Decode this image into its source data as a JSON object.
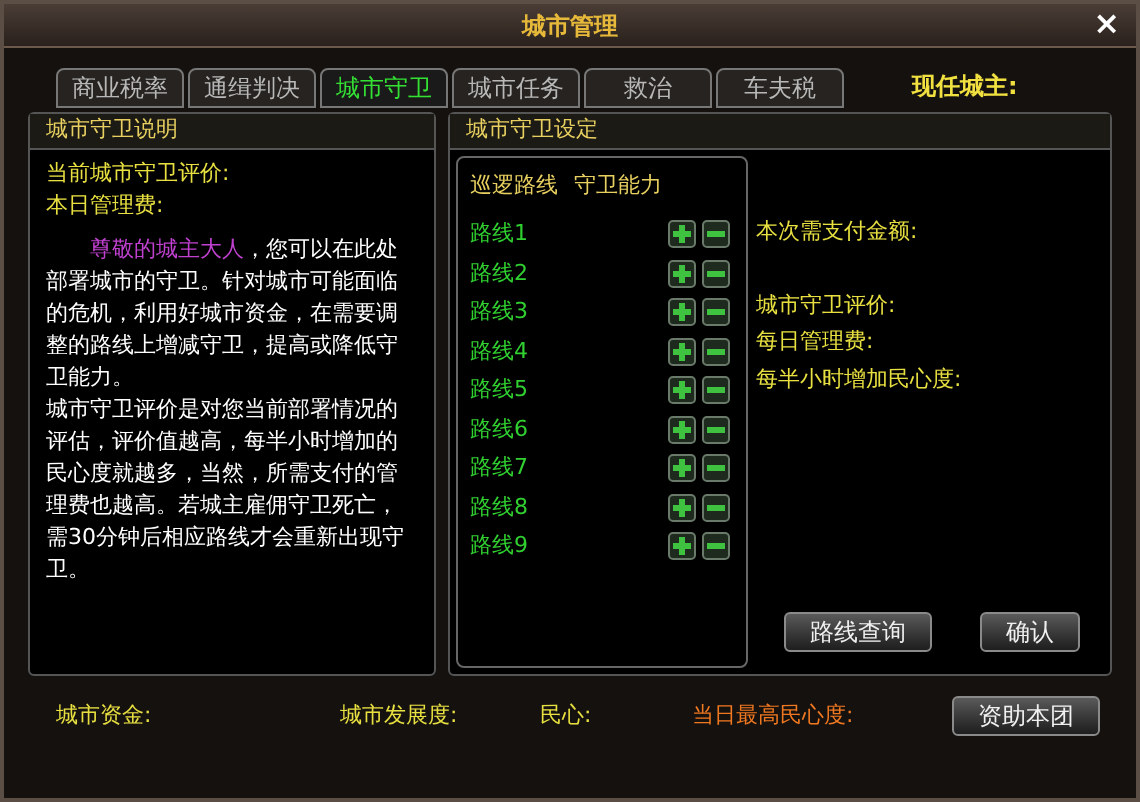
{
  "window": {
    "title": "城市管理",
    "close": "×"
  },
  "tabs": [
    {
      "label": "商业税率",
      "selected": false
    },
    {
      "label": "通缉判决",
      "selected": false
    },
    {
      "label": "城市守卫",
      "selected": true
    },
    {
      "label": "城市任务",
      "selected": false
    },
    {
      "label": "救治",
      "selected": false
    },
    {
      "label": "车夫税",
      "selected": false
    }
  ],
  "current_lord": "现任城主:",
  "description_panel": {
    "title": "城市守卫说明",
    "stats": [
      "当前城市守卫评价:",
      "本日管理费:"
    ],
    "greeting": "尊敬的城主大人",
    "intro": "，您可以在此处部署城市的守卫。针对城市可能面临的危机，利用好城市资金，在需要调整的路线上增减守卫，提高或降低守卫能力。",
    "details": "城市守卫评价是对您当前部署情况的评估，评价值越高，每半小时增加的民心度就越多，当然，所需支付的管理费也越高。若城主雇佣守卫死亡，需30分钟后相应路线才会重新出现守卫。"
  },
  "settings_panel": {
    "title": "城市守卫设定",
    "columns": [
      "巡逻路线",
      "守卫能力"
    ],
    "routes": [
      {
        "name": "路线1"
      },
      {
        "name": "路线2"
      },
      {
        "name": "路线3"
      },
      {
        "name": "路线4"
      },
      {
        "name": "路线5"
      },
      {
        "name": "路线6"
      },
      {
        "name": "路线7"
      },
      {
        "name": "路线8"
      },
      {
        "name": "路线9"
      }
    ],
    "payment_label": "本次需支付金额:",
    "summary": [
      "城市守卫评价:",
      "每日管理费:",
      "每半小时增加民心度:"
    ],
    "buttons": [
      "路线查询",
      "确认"
    ]
  },
  "status_bar": [
    {
      "label": "城市资金:",
      "highlight": false
    },
    {
      "label": "城市发展度:",
      "highlight": false
    },
    {
      "label": "民心:",
      "highlight": false
    },
    {
      "label": "当日最高民心度:",
      "highlight": true
    }
  ],
  "sponsor_button": "资助本团"
}
